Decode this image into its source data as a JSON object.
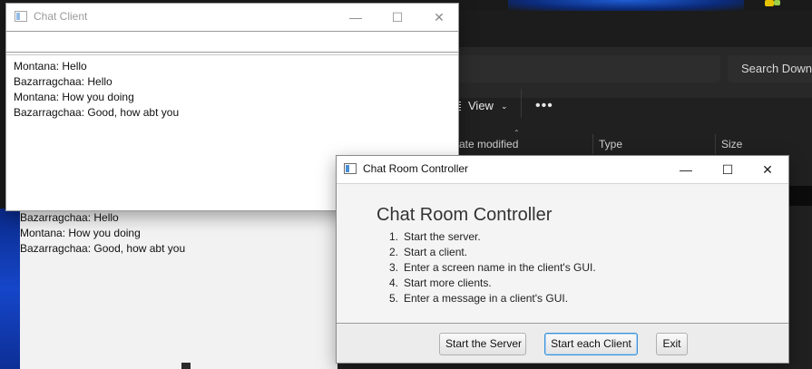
{
  "explorer": {
    "search_placeholder": "Search Down",
    "view_label": "View",
    "more_label": "•••",
    "columns": [
      "ate modified",
      "Type",
      "Size"
    ]
  },
  "background_chat": {
    "messages": [
      "Bazarragchaa: Hello",
      "Montana: How you doing",
      "Bazarragchaa: Good, how abt you"
    ]
  },
  "chat_client": {
    "title": "Chat Client",
    "input_value": "",
    "messages": [
      "Montana: Hello",
      "Bazarragchaa: Hello",
      "Montana: How you doing",
      "Bazarragchaa: Good, how abt you"
    ]
  },
  "controller": {
    "title": "Chat Room Controller",
    "heading": "Chat Room Controller",
    "steps": [
      {
        "num": "1.",
        "text": "Start the server."
      },
      {
        "num": "2.",
        "text": "Start a client."
      },
      {
        "num": "3.",
        "text": "Enter a screen name in the client's GUI."
      },
      {
        "num": "4.",
        "text": "Start more clients."
      },
      {
        "num": "5.",
        "text": "Enter a message in a client's GUI."
      }
    ],
    "buttons": {
      "start_server": "Start the Server",
      "start_client": "Start each Client",
      "exit": "Exit"
    }
  },
  "window_controls": {
    "minimize": "—",
    "maximize": "☐",
    "close": "✕"
  }
}
